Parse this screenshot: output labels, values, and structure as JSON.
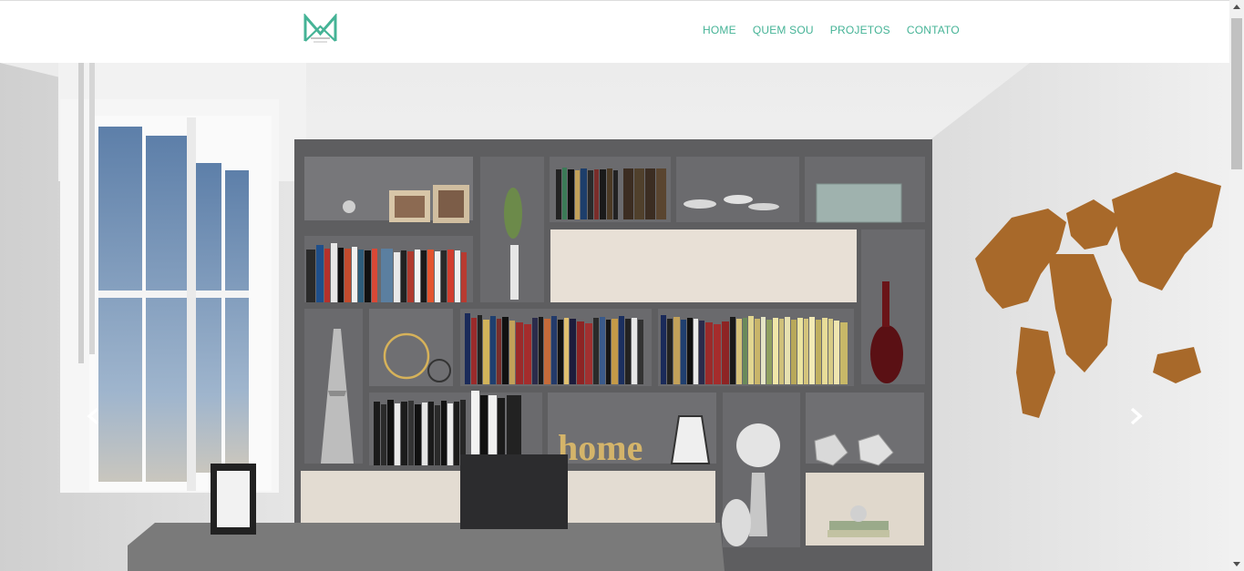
{
  "header": {
    "logo": {
      "icon": "mm-monogram-logo",
      "color": "#45b396"
    },
    "menu": [
      {
        "label": "HOME"
      },
      {
        "label": "QUEM SOU"
      },
      {
        "label": "PROJETOS"
      },
      {
        "label": "CONTATO"
      }
    ]
  },
  "carousel": {
    "slide_image": "home-office-bookshelf-render",
    "prev_icon": "chevron-left-icon",
    "next_icon": "chevron-right-icon",
    "decor_word": "home"
  },
  "colors": {
    "accent": "#45b396",
    "background": "#ffffff",
    "shelving": "#5e5e60"
  }
}
